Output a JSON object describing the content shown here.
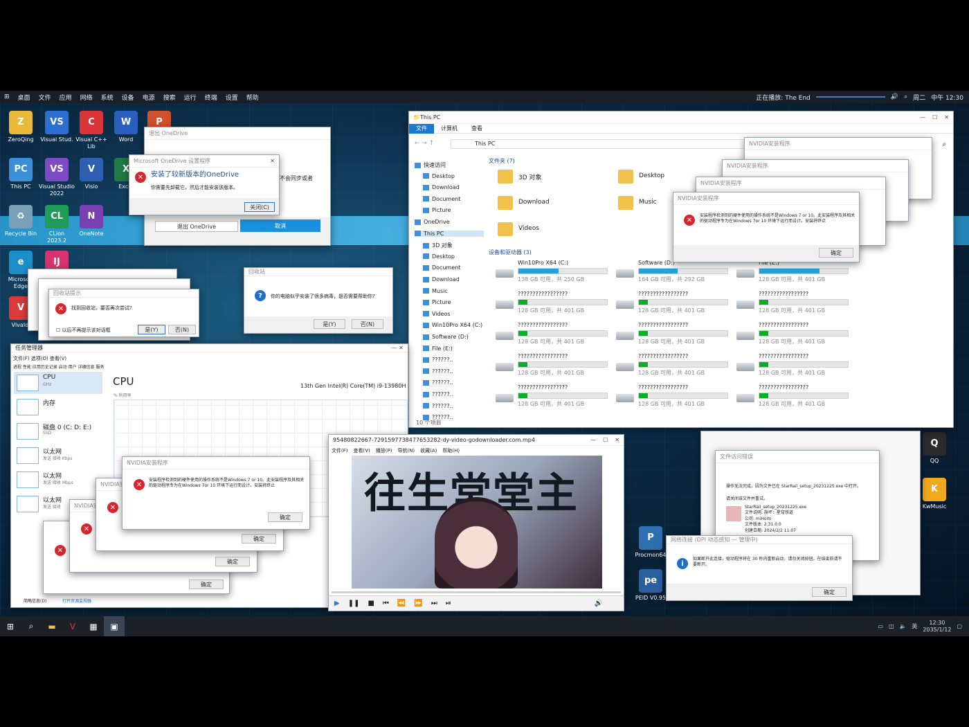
{
  "menubar": {
    "items": [
      "桌面",
      "文件",
      "应用",
      "网络",
      "系统",
      "设备",
      "电源",
      "搜索",
      "运行",
      "终端",
      "设置",
      "帮助"
    ],
    "now_playing": "正在播放: The End",
    "day": "周二",
    "time": "中午 12:30"
  },
  "desktop_icons": [
    {
      "label": "ZeroQing",
      "color": "#e9b93a",
      "glyph": "Z"
    },
    {
      "label": "Visual Stud.",
      "color": "#2c6fd1",
      "glyph": "VS"
    },
    {
      "label": "Visual C++ Lib",
      "color": "#d8343a",
      "glyph": "C"
    },
    {
      "label": "Word",
      "color": "#2b5fbe",
      "glyph": "W"
    },
    {
      "label": "PowerPo.",
      "color": "#d0502b",
      "glyph": "P"
    },
    {
      "label": "This PC",
      "color": "#3a8fd8",
      "glyph": "PC"
    },
    {
      "label": "Visual Studio 2022",
      "color": "#7d4bc3",
      "glyph": "VS"
    },
    {
      "label": "Visio",
      "color": "#2f5fb3",
      "glyph": "V"
    },
    {
      "label": "Exce.",
      "color": "#1f7a45",
      "glyph": "X"
    },
    {
      "label": "Recycle Bin",
      "color": "#7aa0b8",
      "glyph": "♻"
    },
    {
      "label": "CLion 2023.2",
      "color": "#1f9c5a",
      "glyph": "CL"
    },
    {
      "label": "OneNote",
      "color": "#7a3fb0",
      "glyph": "N"
    },
    {
      "label": "Microsoft Edge",
      "color": "#1a8fc9",
      "glyph": "e"
    },
    {
      "label": "Vivaldi",
      "color": "#d93a3a",
      "glyph": "V"
    },
    {
      "label": "IntelliJ",
      "color": "#d8336e",
      "glyph": "IJ"
    },
    {
      "label": "QQ",
      "color": "#2a2a2a",
      "glyph": "Q"
    },
    {
      "label": "KwMusic",
      "color": "#f0a81c",
      "glyph": "K"
    },
    {
      "label": "Procmon64",
      "color": "#2d6fb0",
      "glyph": "P"
    },
    {
      "label": "PEID V0.95",
      "color": "#2a5fa0",
      "glyph": "pe"
    }
  ],
  "onedrive": {
    "back_title": "退出 OneDrive",
    "mid_title": "退出 OneDrive",
    "front_title": "Microsoft OneDrive 设置程序",
    "heading": "安装了较新版本的OneDrive",
    "body": "你需要先卸载它，然后才能安装该版本。",
    "close_btn": "关闭(C)",
    "side_text": "不会同步或者",
    "quit_btn": "退出 OneDrive",
    "ok_btn": "取消"
  },
  "explorer": {
    "title": "This PC",
    "tabs": [
      "文件",
      "计算机",
      "查看"
    ],
    "address": "This PC",
    "folders_header": "文件夹 (7)",
    "folders": [
      "3D 对象",
      "Desktop",
      "Download",
      "Music",
      "Videos"
    ],
    "devices_header": "设备和驱动器 (3)",
    "status": "10 个项目",
    "nav": [
      "快速访问",
      "Desktop",
      "Download",
      "Document",
      "Picture",
      "OneDrive",
      "This PC",
      "3D 对象",
      "Desktop",
      "Document",
      "Download",
      "Music",
      "Picture",
      "Videos",
      "Win10Pro X64 (C:)",
      "Software (D:)",
      "File (E:)",
      "??????..",
      "??????..",
      "??????..",
      "??????..",
      "??????..",
      "??????.."
    ],
    "drives": [
      {
        "name": "Win10Pro X64 (C:)",
        "cap": "138 GB 可用，共 250 GB",
        "used": 0.45
      },
      {
        "name": "Software (D:)",
        "cap": "164 GB 可用，共 292 GB",
        "used": 0.44
      },
      {
        "name": "File (E:)",
        "cap": "128 GB 可用，共 401 GB",
        "used": 0.68
      },
      {
        "name": "?????????????????",
        "cap": "128 GB 可用，共 401 GB",
        "used": 0.1
      },
      {
        "name": "?????????????????",
        "cap": "128 GB 可用，共 401 GB",
        "used": 0.1
      },
      {
        "name": "?????????????????",
        "cap": "128 GB 可用，共 401 GB",
        "used": 0.1
      },
      {
        "name": "?????????????????",
        "cap": "128 GB 可用，共 401 GB",
        "used": 0.1
      },
      {
        "name": "?????????????????",
        "cap": "128 GB 可用，共 401 GB",
        "used": 0.1
      },
      {
        "name": "?????????????????",
        "cap": "128 GB 可用，共 401 GB",
        "used": 0.1
      },
      {
        "name": "?????????????????",
        "cap": "128 GB 可用，共 401 GB",
        "used": 0.1
      },
      {
        "name": "?????????????????",
        "cap": "128 GB 可用，共 401 GB",
        "used": 0.1
      },
      {
        "name": "?????????????????",
        "cap": "128 GB 可用，共 401 GB",
        "used": 0.1
      },
      {
        "name": "?????????????????",
        "cap": "128 GB 可用，共 401 GB",
        "used": 0.1
      },
      {
        "name": "?????????????????",
        "cap": "128 GB 可用，共 401 GB",
        "used": 0.1
      },
      {
        "name": "?????????????????",
        "cap": "128 GB 可用，共 401 GB",
        "used": 0.1
      }
    ]
  },
  "nvidia": {
    "title": "NVIDIA安装程序",
    "body": "安装程序检测到的硬件使用的操作系统不是Windows 7 or 10。此安装程序及其相关的驱动程序专为在Windows 7or 10 环境下运行而设计。安装将终止",
    "ok": "确定"
  },
  "recycle_dialog": {
    "title": "回收站提示",
    "body": "找到回收站，要否再次尝试?",
    "checkbox": "以后不再提示该对话框",
    "yes": "是(Y)",
    "no": "否(N)"
  },
  "question_dialog": {
    "title": "回收站",
    "body": "你的电脑似乎安装了很多病毒，是否需要帮助你?",
    "yes": "是(Y)",
    "no": "否(N)"
  },
  "taskmgr": {
    "title": "任务管理器",
    "menu": "文件(F)  选项(O)  查看(V)",
    "tabs": "进程  性能  应用历史记录  启动  用户  详细信息  服务",
    "heading": "CPU",
    "subheading": "% 利用率",
    "cpu_model": "13th Gen Intel(R) Core(TM) i9-13980H",
    "items": [
      {
        "name": "CPU",
        "sub": "GHz"
      },
      {
        "name": "内存",
        "sub": ""
      },
      {
        "name": "磁盘 0 (C: D: E:)",
        "sub": "SSD"
      },
      {
        "name": "以太网",
        "sub": "发送  接收  Kbps"
      },
      {
        "name": "以太网",
        "sub": "发送  接收  Mbps"
      },
      {
        "name": "以太网",
        "sub": "发送  接收"
      }
    ],
    "footer_less": "简略信息(D)",
    "footer_monitor": "打开资源监视器"
  },
  "player": {
    "title": "95480822667-729159773847765328​2-dy-video-godownloader.com.mp4",
    "menu": [
      "文件(F)",
      "查看(V)",
      "播放(P)",
      "导航(N)",
      "收藏(A)",
      "帮助(H)"
    ],
    "banner": "往生堂堂主"
  },
  "file_error": {
    "title": "文件访问错误",
    "body": "操作无法完成，因为文件已在 StarRail_setup_20231225.exe 中打开。",
    "close_hint": "请关闭该文件并重试。",
    "file_name": "StarRail_setup_20231225.exe",
    "desc": "文件说明: 崩坏：星穹铁道",
    "company": "公司: miHoYo",
    "version": "文件版本: 2.31.0.0",
    "created": "创建日期: 2024/2/2 11:07"
  },
  "network_dialog": {
    "title": "网络连接 (DPI 动态感知 — 管理中)",
    "body": "如果断开此连接，驱动程序将在 30 秒内重新启动，请勿关闭按钮。在结束前请不要断开。",
    "ok": "确定"
  },
  "taskbar": {
    "lang": "英",
    "time": "12:30",
    "date": "2035/1/12"
  }
}
